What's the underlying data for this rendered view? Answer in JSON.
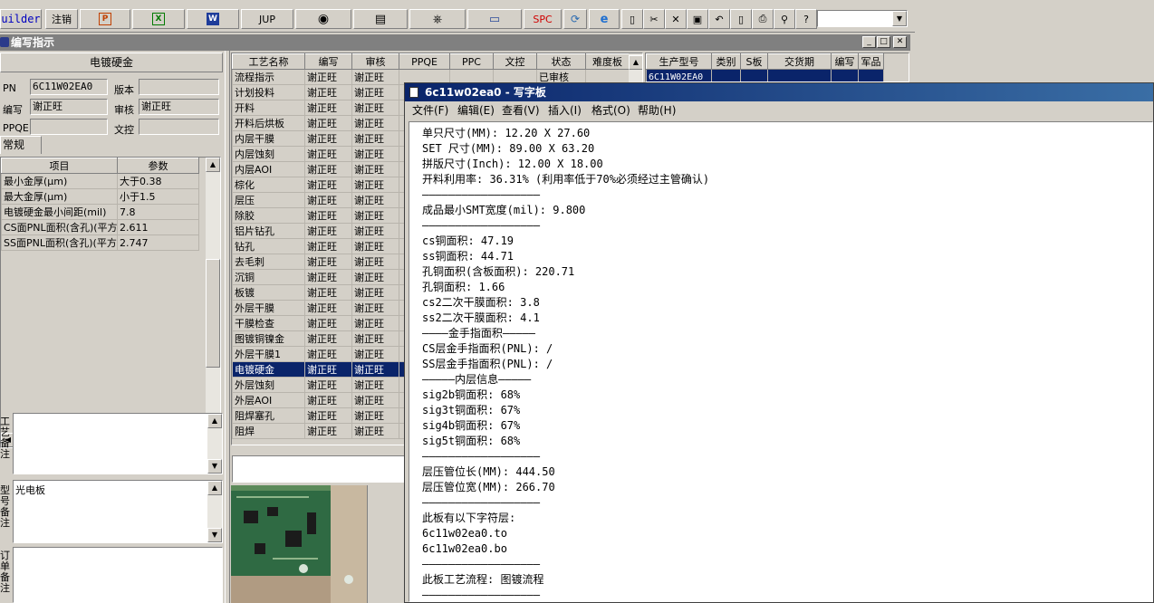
{
  "toolbar": {
    "builder_label": "uilder",
    "logout_label": "注销",
    "jup_label": "JUP",
    "spc_label": "SPC",
    "icons": [
      "ppt-icon",
      "excel-icon",
      "word-icon",
      "eye-icon",
      "db-icon",
      "network-icon",
      "computer-icon",
      "refresh-icon",
      "ie-icon",
      "new-doc-icon",
      "cut-icon",
      "delete-icon",
      "save-icon",
      "undo-icon",
      "preview-icon",
      "print-icon",
      "find-icon",
      "help-icon"
    ],
    "combo_value": ""
  },
  "child_window": {
    "title": "编写指示"
  },
  "left": {
    "section_title": "电镀硬金",
    "pn_label": "PN",
    "pn_value": "6C11W02EA0",
    "version_label": "版本",
    "version_value": "",
    "author_label": "编写",
    "author_value": "谢正旺",
    "review_label": "审核",
    "review_value": "谢正旺",
    "ppqe_label": "PPQE",
    "ppqe_value": "",
    "doc_label": "文控",
    "doc_value": "",
    "tab_label": "常规",
    "param_headers": [
      "项目",
      "参数"
    ],
    "params": [
      [
        "最小金厚(μm)",
        "大于0.38"
      ],
      [
        "最大金厚(μm)",
        "小于1.5"
      ],
      [
        "电镀硬金最小间距(mil)",
        "7.8"
      ],
      [
        "CS面PNL面积(含孔)(平方",
        "2.611"
      ],
      [
        "SS面PNL面积(含孔)(平方",
        "2.747"
      ]
    ],
    "remark_craft_label": "工艺备注",
    "remark_craft_value": "",
    "remark_model_label": "型号备注",
    "remark_model_value": "光电板",
    "remark_order_label": "订单备注",
    "remark_order_value": ""
  },
  "process": {
    "headers": [
      "工艺名称",
      "编写",
      "审核",
      "PPQE",
      "PPC",
      "文控",
      "状态",
      "难度板"
    ],
    "status_first": "已审核",
    "rows": [
      [
        "流程指示",
        "谢正旺",
        "谢正旺"
      ],
      [
        "计划投料",
        "谢正旺",
        "谢正旺"
      ],
      [
        "开料",
        "谢正旺",
        "谢正旺"
      ],
      [
        "开料后烘板",
        "谢正旺",
        "谢正旺"
      ],
      [
        "内层干膜",
        "谢正旺",
        "谢正旺"
      ],
      [
        "内层蚀刻",
        "谢正旺",
        "谢正旺"
      ],
      [
        "内层AOI",
        "谢正旺",
        "谢正旺"
      ],
      [
        "棕化",
        "谢正旺",
        "谢正旺"
      ],
      [
        "层压",
        "谢正旺",
        "谢正旺"
      ],
      [
        "除胶",
        "谢正旺",
        "谢正旺"
      ],
      [
        "铝片钻孔",
        "谢正旺",
        "谢正旺"
      ],
      [
        "钻孔",
        "谢正旺",
        "谢正旺"
      ],
      [
        "去毛刺",
        "谢正旺",
        "谢正旺"
      ],
      [
        "沉铜",
        "谢正旺",
        "谢正旺"
      ],
      [
        "板镀",
        "谢正旺",
        "谢正旺"
      ],
      [
        "外层干膜",
        "谢正旺",
        "谢正旺"
      ],
      [
        "干膜检查",
        "谢正旺",
        "谢正旺"
      ],
      [
        "图镀铜镍金",
        "谢正旺",
        "谢正旺"
      ],
      [
        "外层干膜1",
        "谢正旺",
        "谢正旺"
      ],
      [
        "电镀硬金",
        "谢正旺",
        "谢正旺"
      ],
      [
        "外层蚀刻",
        "谢正旺",
        "谢正旺"
      ],
      [
        "外层AOI",
        "谢正旺",
        "谢正旺"
      ],
      [
        "阻焊塞孔",
        "谢正旺",
        "谢正旺"
      ],
      [
        "阻焊",
        "谢正旺",
        "谢正旺"
      ]
    ],
    "selected_index": 19
  },
  "orders": {
    "headers": [
      "生产型号",
      "类别",
      "S板",
      "交货期",
      "编写",
      "军品"
    ],
    "first_model": "6C11W02EA0"
  },
  "notepad": {
    "title": "6c11w02ea0 - 写字板",
    "menu": [
      "文件(F)",
      "编辑(E)",
      "查看(V)",
      "插入(I)",
      "格式(O)",
      "帮助(H)"
    ],
    "lines": [
      "单只尺寸(MM): 12.20 X 27.60",
      "SET 尺寸(MM): 89.00 X 63.20",
      "拼版尺寸(Inch): 12.00 X 18.00",
      "开料利用率: 36.31% (利用率低于70%必须经过主管确认)",
      "——————————————————",
      "成品最小SMT宽度(mil): 9.800",
      "——————————————————",
      "cs铜面积: 47.19",
      "ss铜面积: 44.71",
      "孔铜面积(含板面积): 220.71",
      "孔铜面积: 1.66",
      "cs2二次干膜面积: 3.8",
      "ss2二次干膜面积: 4.1",
      "————金手指面积—————",
      "CS层金手指面积(PNL): /",
      "SS层金手指面积(PNL): /",
      "—————内层信息—————",
      "sig2b铜面积: 68%",
      "sig3t铜面积: 67%",
      "sig4b铜面积: 67%",
      "sig5t铜面积: 68%",
      "——————————————————",
      "层压管位长(MM): 444.50",
      "层压管位宽(MM): 266.70",
      "——————————————————",
      "此板有以下字符层:",
      "6c11w02ea0.to",
      "6c11w02ea0.bo",
      "——————————————————",
      "此板工艺流程: 图镀流程",
      "——————————————————"
    ]
  }
}
